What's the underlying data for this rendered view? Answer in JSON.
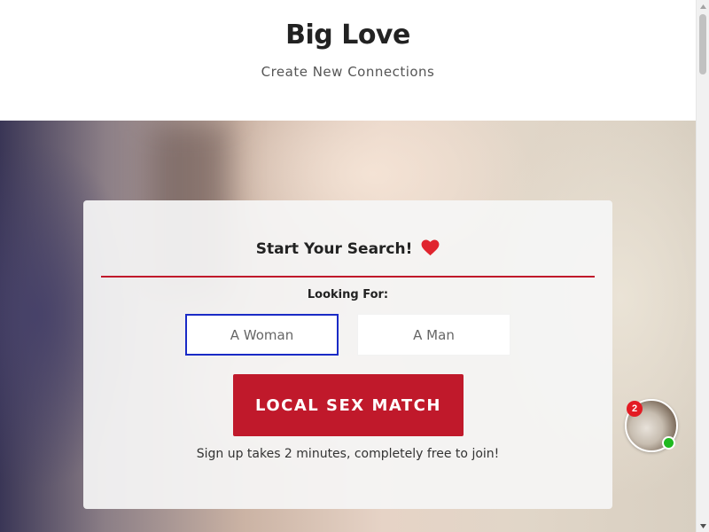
{
  "header": {
    "title": "Big Love",
    "tagline": "Create New Connections"
  },
  "search_card": {
    "heading": "Start Your Search!",
    "heading_icon": "heart-icon",
    "looking_for_label": "Looking For:",
    "options": [
      {
        "label": "A Woman",
        "selected": true
      },
      {
        "label": "A Man",
        "selected": false
      }
    ],
    "cta_label": "LOCAL SEX MATCH",
    "signup_note": "Sign up takes 2 minutes, completely free to join!"
  },
  "chat_widget": {
    "unread_count": "2",
    "status": "online"
  },
  "colors": {
    "accent": "#c0192b",
    "selected_border": "#1a2bc6",
    "heart": "#e0242e",
    "online": "#1fb91f"
  }
}
